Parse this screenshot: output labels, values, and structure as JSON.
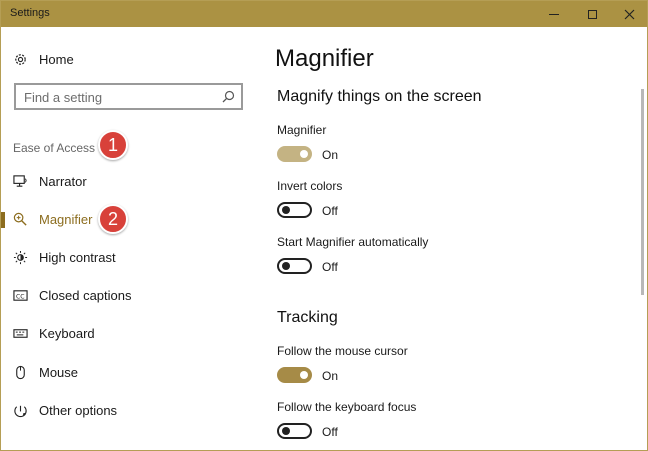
{
  "window": {
    "title": "Settings"
  },
  "sidebar": {
    "home_label": "Home",
    "search_placeholder": "Find a setting",
    "category": "Ease of Access",
    "items": [
      {
        "label": "Narrator",
        "icon": "narrator-icon"
      },
      {
        "label": "Magnifier",
        "icon": "magnifier-icon",
        "selected": true
      },
      {
        "label": "High contrast",
        "icon": "high-contrast-icon"
      },
      {
        "label": "Closed captions",
        "icon": "closed-captions-icon"
      },
      {
        "label": "Keyboard",
        "icon": "keyboard-icon"
      },
      {
        "label": "Mouse",
        "icon": "mouse-icon"
      },
      {
        "label": "Other options",
        "icon": "other-options-icon"
      }
    ]
  },
  "annotations": {
    "badge1": "1",
    "badge2": "2"
  },
  "main": {
    "title": "Magnifier",
    "section1": "Magnify things on the screen",
    "magnifier": {
      "label": "Magnifier",
      "state": "On"
    },
    "invert": {
      "label": "Invert colors",
      "state": "Off"
    },
    "auto": {
      "label": "Start Magnifier automatically",
      "state": "Off"
    },
    "section2": "Tracking",
    "mouse": {
      "label": "Follow the mouse cursor",
      "state": "On"
    },
    "keyboard": {
      "label": "Follow the keyboard focus",
      "state": "Off"
    }
  },
  "colors": {
    "accent": "#8c6d1f",
    "titlebar": "#ab9243",
    "badge": "#d8413a"
  }
}
